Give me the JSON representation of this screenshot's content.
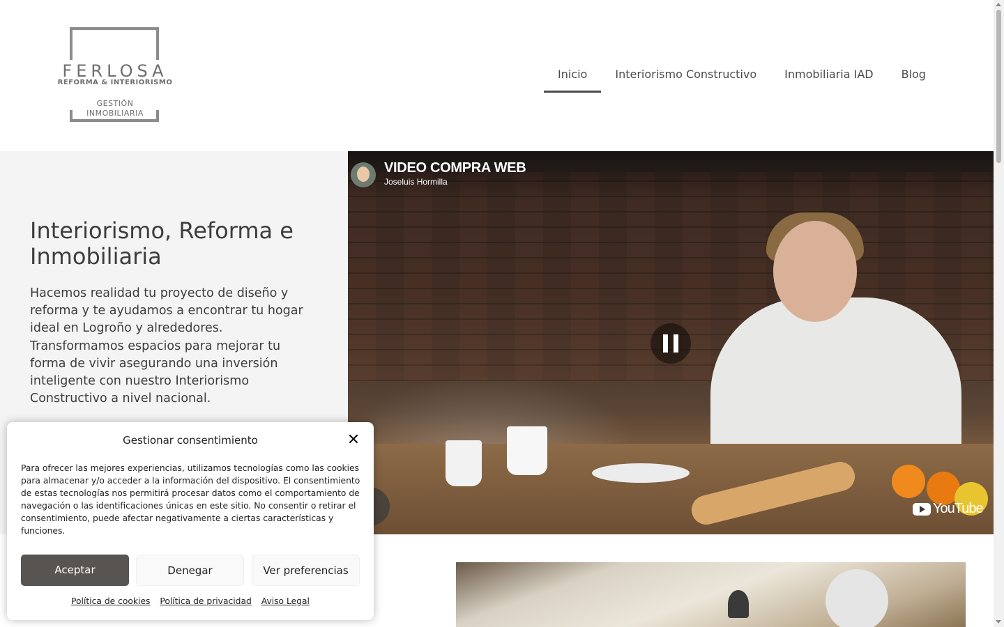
{
  "header": {
    "logo": {
      "brand": "FERLOSA",
      "tagline": "REFORMA & INTERIORISMO",
      "sub_line1": "GESTIÓN",
      "sub_line2": "INMOBILIARIA"
    },
    "nav": [
      {
        "label": "Inicio",
        "active": true
      },
      {
        "label": "Interiorismo Constructivo",
        "active": false
      },
      {
        "label": "Inmobiliaria IAD",
        "active": false
      },
      {
        "label": "Blog",
        "active": false
      }
    ]
  },
  "hero": {
    "title": "Interiorismo, Reforma e Inmobiliaria",
    "text": "Hacemos realidad tu proyecto de diseño y reforma y te ayudamos a encontrar tu hogar ideal en Logroño y alrededores. Transformamos espacios para mejorar tu forma de vivir asegurando una inversión inteligente con nuestro Interiorismo Constructivo a nivel nacional."
  },
  "video": {
    "title": "VIDEO COMPRA WEB",
    "channel": "Joseluis Hormilla",
    "state": "playing",
    "platform": "YouTube"
  },
  "cookie_banner": {
    "title": "Gestionar consentimiento",
    "text": "Para ofrecer las mejores experiencias, utilizamos tecnologías como las cookies para almacenar y/o acceder a la información del dispositivo. El consentimiento de estas tecnologías nos permitirá procesar datos como el comportamiento de navegación o las identificaciones únicas en este sitio. No consentir o retirar el consentimiento, puede afectar negativamente a ciertas características y funciones.",
    "accept_label": "Aceptar",
    "deny_label": "Denegar",
    "prefs_label": "Ver preferencias",
    "links": [
      "Política de cookies",
      "Política de privacidad",
      "Aviso Legal"
    ]
  },
  "colors": {
    "accept_button": "#575452",
    "hero_background": "#f4f4f4",
    "nav_text": "#4a4a4a"
  }
}
